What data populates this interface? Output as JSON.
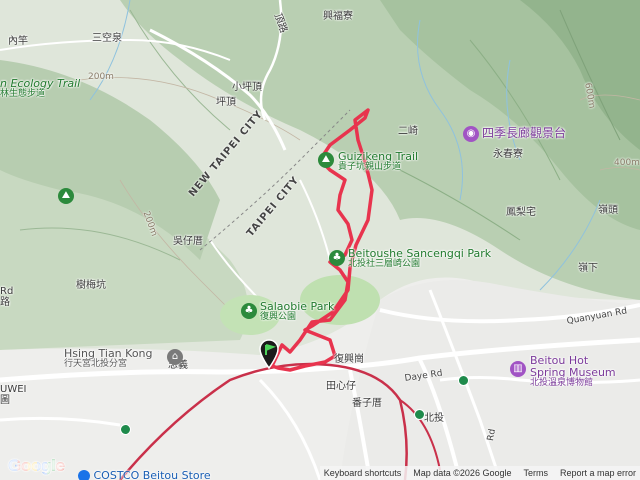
{
  "labels": {
    "neihu": "內竿",
    "sankongquan": "三空泉",
    "xingfuliao": "興福寮",
    "xiaopingding": "小坪頂",
    "pingding": "坪頂",
    "erqi": "二崎",
    "yongchunliao": "永春寮",
    "fenglizhai": "鳳梨宅",
    "lingtou": "嶺頭",
    "lingxia": "嶺下",
    "wuzicuo": "吳仔厝",
    "shumeikeng": "樹梅坑",
    "zhongyi": "忠義",
    "fuxinggang": "復興崗",
    "tianxincun": "田心仔",
    "fanzicuo": "番子厝",
    "beitou": "北投",
    "wei": "UWEI",
    "wei_sub": "圖",
    "road_left": "Rd",
    "road_left2": "路",
    "road_top": "頂路"
  },
  "boundary": {
    "new_taipei": "NEW TAIPEI CITY",
    "taipei": "TAIPEI CITY"
  },
  "places": {
    "ecology_trail": "n Ecology Trail",
    "ecology_trail_sub": "林生態步道",
    "guizikeng": "Guizikeng Trail",
    "guizikeng_sub": "貴子坑親山步道",
    "sancengqi": "Beitoushe Sancengqi Park",
    "sancengqi_sub": "北投社三層崎公園",
    "salaobie": "Salaobie Park",
    "salaobie_sub": "復興公園",
    "hsingtiankong": "Hsing Tian Kong",
    "hsingtiankong_sub": "行天宮北投分宮",
    "sijichanglang": "四季長廊觀景台",
    "spring_museum": "Beitou Hot Spring Museum",
    "spring_museum_l1": "Beitou Hot",
    "spring_museum_l2": "Spring Museum",
    "spring_museum_sub": "北投溫泉博物館",
    "costco": "COSTCO Beitou Store"
  },
  "roads": {
    "quanyuan": "Quanyuan Rd",
    "daye": "Daye Rd",
    "rd_right": "Rd"
  },
  "contours": {
    "c200_a": "200m",
    "c200_b": "200m",
    "c600": "600m",
    "c400": "400m"
  },
  "footer": {
    "keyboard": "Keyboard shortcuts",
    "mapdata": "Map data ©2026 Google",
    "terms": "Terms",
    "report": "Report a map error"
  },
  "google": {
    "logo": "Google"
  },
  "colors": {
    "track": "#e8344e",
    "park_green": "#2c8a3c",
    "attraction_purple": "#a154c4",
    "railway": "#c9304a"
  }
}
